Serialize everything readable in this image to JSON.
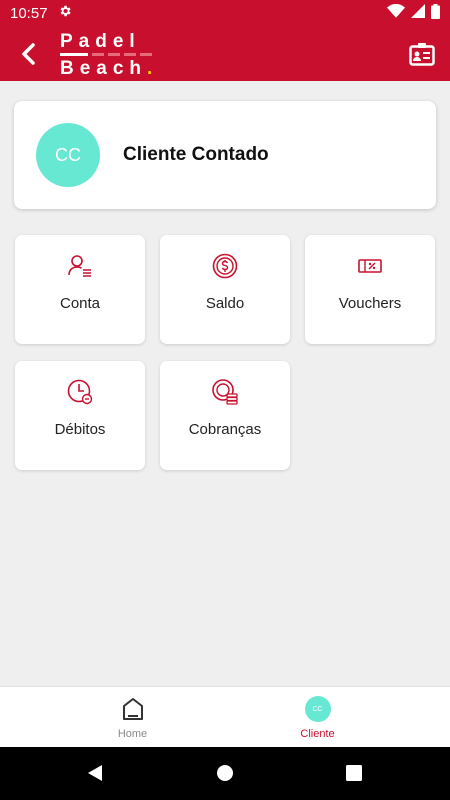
{
  "status_bar": {
    "time": "10:57"
  },
  "header": {
    "logo_line1": "Padel",
    "logo_line2": "Beach",
    "logo_dot": ".",
    "brand_color": "#c8102e"
  },
  "client": {
    "initials": "CC",
    "name": "Cliente Contado",
    "avatar_color": "#67e8d2"
  },
  "menu": {
    "tiles": [
      {
        "label": "Conta",
        "icon": "user-list-icon"
      },
      {
        "label": "Saldo",
        "icon": "dollar-coin-icon"
      },
      {
        "label": "Vouchers",
        "icon": "voucher-ticket-icon"
      },
      {
        "label": "Débitos",
        "icon": "clock-debit-icon"
      },
      {
        "label": "Cobranças",
        "icon": "coins-stack-icon"
      }
    ]
  },
  "bottom_nav": {
    "items": [
      {
        "label": "Home",
        "icon": "home-icon",
        "active": false
      },
      {
        "label": "Cliente",
        "icon": "cliente-avatar",
        "avatar_text": "CC",
        "active": true
      }
    ],
    "active_color": "#c8102e",
    "inactive_color": "#888888"
  }
}
